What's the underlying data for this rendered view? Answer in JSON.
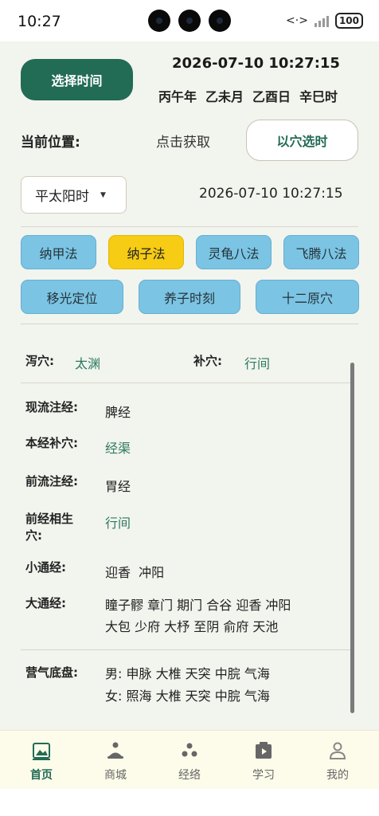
{
  "status_bar": {
    "time": "10:27",
    "battery": "100"
  },
  "header": {
    "select_time_button": "选择时间",
    "datetime": "2026-07-10 10:27:15",
    "ganzhi": [
      "丙午年",
      "乙未月",
      "乙酉日",
      "辛巳时"
    ]
  },
  "location": {
    "label": "当前位置:",
    "action": "点击获取",
    "select_by_point_button": "以穴选时"
  },
  "time_mode": {
    "selected": "平太阳时",
    "datetime": "2026-07-10 10:27:15"
  },
  "methods": {
    "row1": [
      "纳甲法",
      "纳子法",
      "灵龟八法",
      "飞腾八法"
    ],
    "row2": [
      "移光定位",
      "养子时刻",
      "十二原穴"
    ],
    "active": "纳子法"
  },
  "result": {
    "xie_label": "泻穴:",
    "xie_value": "太渊",
    "bu_label": "补穴:",
    "bu_value": "行间",
    "current_meridian_label": "现流注经:",
    "current_meridian_value": "脾经",
    "same_meridian_label": "本经补穴:",
    "same_meridian_value": "经渠",
    "prev_meridian_label": "前流注经:",
    "prev_meridian_value": "胃经",
    "prev_generate_label_1": "前经相生",
    "prev_generate_label_2": "穴:",
    "prev_generate_value": "行间",
    "small_pass_label": "小通经:",
    "small_pass_value": "迎香  冲阳",
    "big_pass_label": "大通经:",
    "big_pass_line1": "瞳子髎 章门 期门 合谷 迎香 冲阳",
    "big_pass_line2": "大包 少府 大杼 至阴 俞府 天池",
    "ying_label": "营气底盘:",
    "ying_male": "男: 申脉 大椎 天突 中脘 气海",
    "ying_female": "女: 照海 大椎 天突 中脘 气海"
  },
  "tabbar": {
    "items": [
      "首页",
      "商城",
      "经络",
      "学习",
      "我的"
    ],
    "active": "首页"
  },
  "colors": {
    "primary": "#226b55",
    "method_bg": "#7cc4e3",
    "method_active": "#f6cc14",
    "page_bg": "#f2f4ee"
  }
}
